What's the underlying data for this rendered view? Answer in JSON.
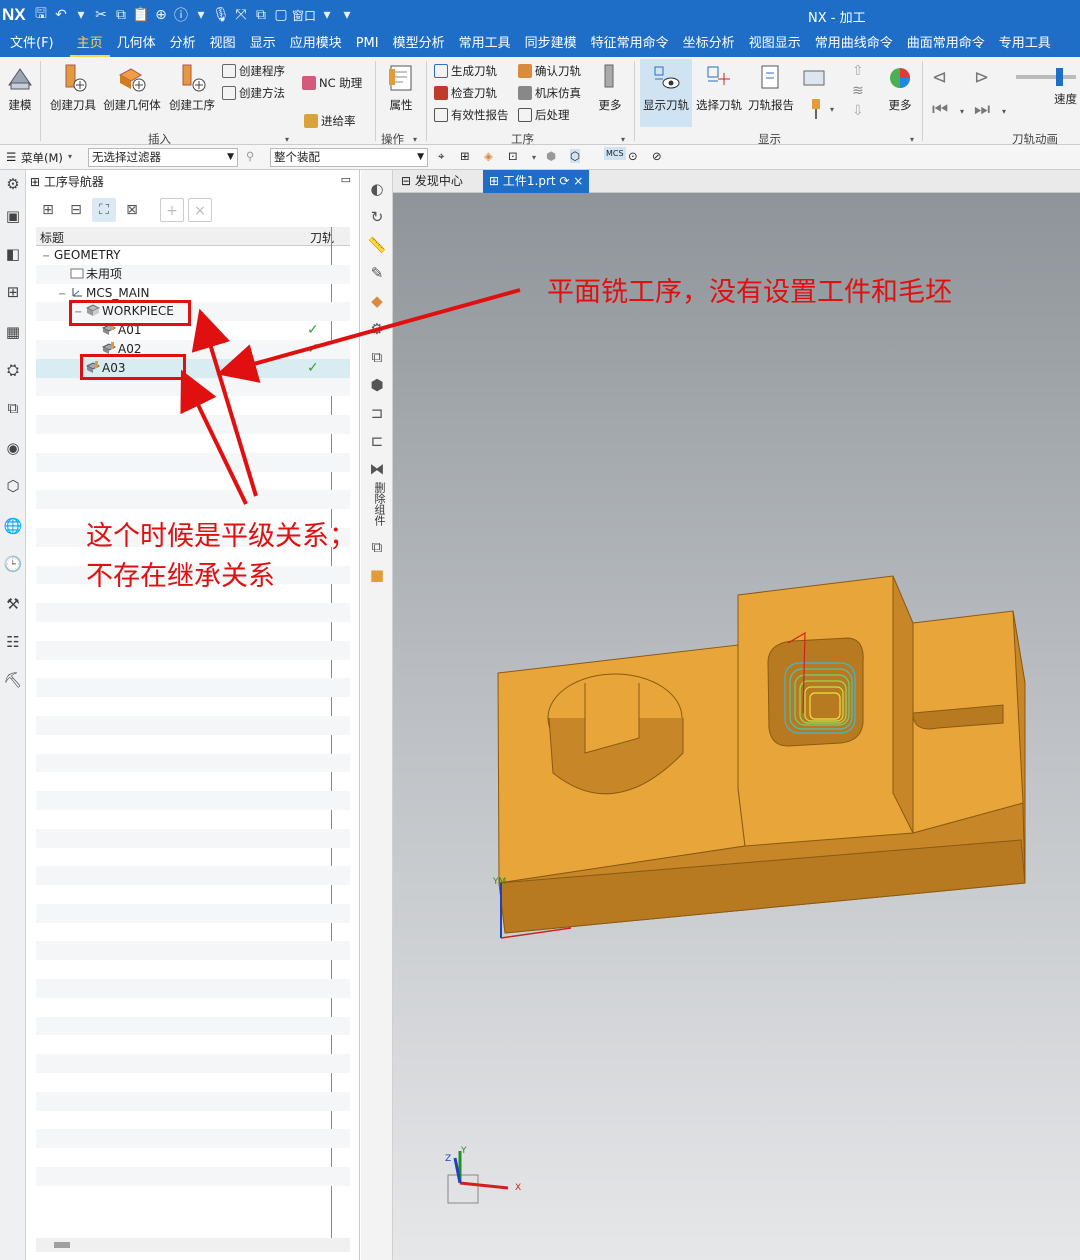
{
  "titlebar": {
    "logo": "NX",
    "window_menu": "窗口",
    "app_title": "NX - 加工"
  },
  "menubar": {
    "items": [
      "文件(F)",
      "主页",
      "几何体",
      "分析",
      "视图",
      "显示",
      "应用模块",
      "PMI",
      "模型分析",
      "常用工具",
      "同步建模",
      "特征常用命令",
      "坐标分析",
      "视图显示",
      "常用曲线命令",
      "曲面常用命令",
      "专用工具"
    ],
    "active": "主页"
  },
  "ribbon": {
    "build": "建模",
    "create_tool": "创建刀具",
    "create_geometry": "创建几何体",
    "create_operation": "创建工序",
    "create_program": "创建程序",
    "create_method": "创建方法",
    "nc_assistant": "NC 助理",
    "feed_rate": "进给率",
    "properties": "属性",
    "generate_path": "生成刀轨",
    "verify_path": "确认刀轨",
    "check_path": "检查刀轨",
    "machine_sim": "机床仿真",
    "validity_report": "有效性报告",
    "postprocess": "后处理",
    "more1": "更多",
    "show_path": "显示刀轨",
    "select_path": "选择刀轨",
    "path_report": "刀轨报告",
    "more2": "更多",
    "speed": "速度",
    "group_insert": "插入",
    "group_operate": "操作",
    "group_operation": "工序",
    "group_display": "显示",
    "group_animation": "刀轨动画"
  },
  "filterbar": {
    "menu": "菜单(M)",
    "filter": "无选择过滤器",
    "assembly": "整个装配"
  },
  "navigator": {
    "title": "工序导航器",
    "col_title": "标题",
    "col_path": "刀轨",
    "rows": [
      {
        "label": "GEOMETRY",
        "indent": 0,
        "expander": "−",
        "icon": "none"
      },
      {
        "label": "未用项",
        "indent": 1,
        "expander": "",
        "icon": "folder"
      },
      {
        "label": "MCS_MAIN",
        "indent": 1,
        "expander": "−",
        "icon": "mcs"
      },
      {
        "label": "WORKPIECE",
        "indent": 2,
        "expander": "−",
        "icon": "workpiece"
      },
      {
        "label": "A01",
        "indent": 3,
        "expander": "",
        "icon": "op",
        "check": "✓"
      },
      {
        "label": "A02",
        "indent": 3,
        "expander": "",
        "icon": "op",
        "check": "✓"
      },
      {
        "label": "A03",
        "indent": 2,
        "expander": "",
        "icon": "op",
        "check": "✓",
        "selected": true
      }
    ]
  },
  "vbar": {
    "label": "删除组件"
  },
  "tabs": {
    "discovery": "发现中心",
    "part": "工件1.prt"
  },
  "viewport": {
    "triad_x": "X",
    "triad_y": "Y",
    "triad_z": "Z",
    "wcs_label": "YM"
  },
  "annotations": {
    "note1": "平面铣工序，没有设置工件和毛坯",
    "note2_line1": "这个时候是平级关系；",
    "note2_line2": "不存在继承关系"
  },
  "colors": {
    "title_blue": "#1e6ec8",
    "active_menu": "#ffd54a",
    "annotation_red": "#e01010",
    "part_orange": "#e8a63a",
    "check_green": "#3a9a3a"
  }
}
